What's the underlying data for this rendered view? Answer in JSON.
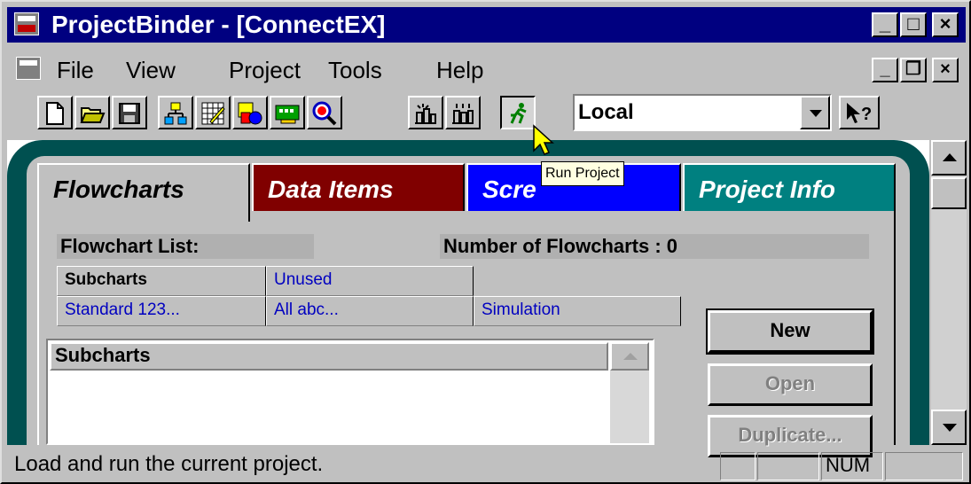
{
  "window": {
    "title": "ProjectBinder - [ConnectEX]",
    "controls": {
      "minimize": "_",
      "maximize": "□",
      "close": "×"
    }
  },
  "menu": {
    "items": [
      "File",
      "View",
      "Project",
      "Tools",
      "Help"
    ],
    "doc_controls": {
      "minimize": "_",
      "restore": "❐",
      "close": "×"
    }
  },
  "toolbar": {
    "tools": [
      "new-file-icon",
      "open-folder-icon",
      "save-disk-icon",
      "hierarchy-icon",
      "grid-edit-icon",
      "shapes-icon",
      "card-icon",
      "magnifier-icon",
      "build-icon",
      "build-all-icon",
      "run-project-icon"
    ],
    "location_value": "Local",
    "help_icon": "context-help-icon"
  },
  "tooltip": {
    "text": "Run Project"
  },
  "tabs": [
    {
      "label": "Flowcharts",
      "color": "#c0c0c0"
    },
    {
      "label": "Data Items",
      "color": "#800000"
    },
    {
      "label": "Scre",
      "color": "#0000ff"
    },
    {
      "label": "Project Info",
      "color": "#008080"
    }
  ],
  "flowcharts": {
    "list_label": "Flowchart List:",
    "count_label": "Number of Flowcharts : 0",
    "subtabs_row1": [
      "Subcharts",
      "Unused"
    ],
    "subtabs_row2": [
      "Standard 123...",
      "All abc...",
      "Simulation"
    ],
    "list_header": "Subcharts",
    "buttons": {
      "new": "New",
      "open": "Open",
      "duplicate": "Duplicate..."
    }
  },
  "status": {
    "text": "Load and run the current project.",
    "num": "NUM"
  }
}
